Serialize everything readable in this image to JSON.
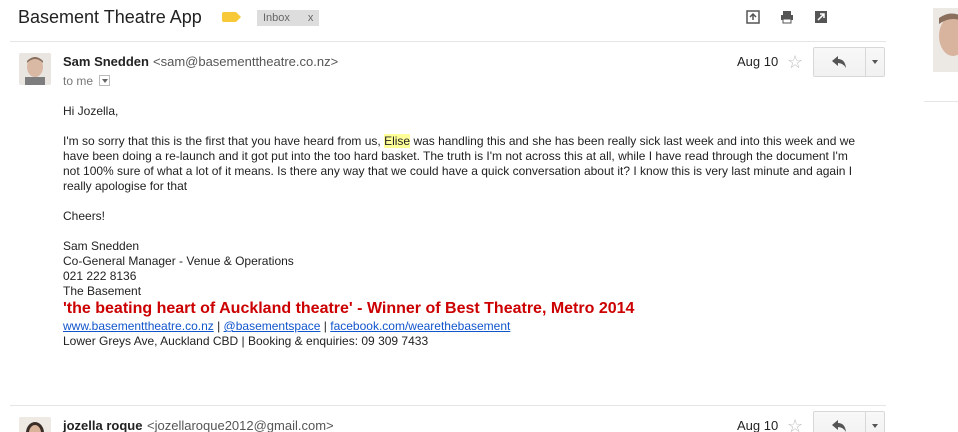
{
  "thread": {
    "subject": "Basement Theatre App",
    "label_color": "#f7c938",
    "inbox_chip": {
      "label": "Inbox",
      "remove": "x"
    },
    "toolbar_icons": [
      "popout-arrow-icon",
      "print-icon",
      "new-window-icon"
    ]
  },
  "messages": [
    {
      "sender_name": "Sam Snedden",
      "sender_email": "<sam@basementtheatre.co.nz>",
      "to_line": "to me",
      "date": "Aug 10",
      "greeting": "Hi Jozella,",
      "para_before": "I'm so sorry that this is the first that you have heard from us, ",
      "para_highlight": "Elise",
      "para_after": " was handling this and she has been really sick last week and into this week and we have been doing a re-launch and it got put into the too hard basket.  The truth is I'm not across this at all, while I have read through the document I'm not 100% sure of what a lot of it means. Is there any way that we could have a quick conversation about it? I know this is very last minute and again I really apologise for that",
      "signoff": "Cheers!",
      "signature": {
        "name": "Sam Snedden",
        "title": "Co-General Manager - Venue & Operations",
        "phone": "021 222 8136",
        "org": "The Basement"
      },
      "tagline": "'the beating heart of Auckland theatre' - Winner of Best Theatre, Metro 2014",
      "links": {
        "site": "www.basementtheatre.co.nz",
        "sep1": " | ",
        "twitter": "@basementspace",
        "sep2": " | ",
        "facebook": "facebook.com/wearethebasement"
      },
      "address": "Lower Greys Ave, Auckland CBD | Booking & enquiries: 09 309 7433"
    },
    {
      "sender_name": "jozella roque",
      "sender_email": "<jozellaroque2012@gmail.com>",
      "date": "Aug 10"
    }
  ],
  "colors": {
    "tagline": "#cc0000",
    "link": "#1155cc",
    "highlight": "#ffff99"
  }
}
